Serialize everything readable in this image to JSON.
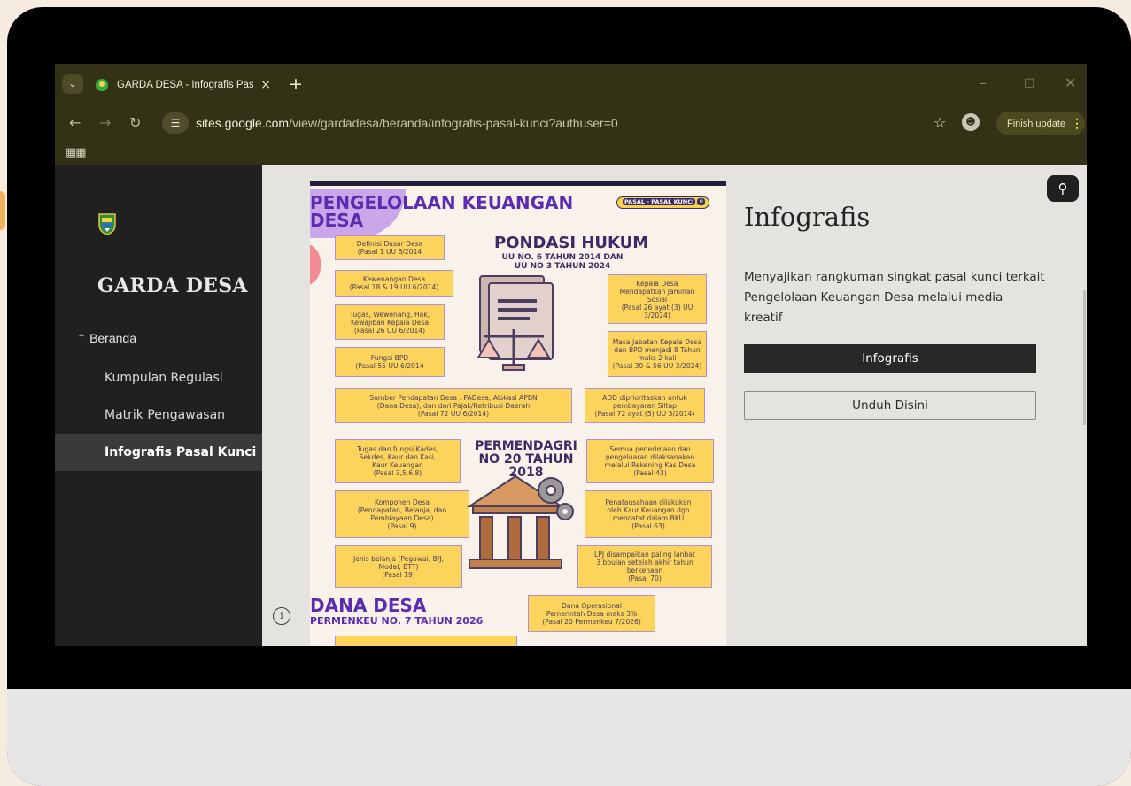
{
  "browser": {
    "tab_title": "GARDA DESA - Infografis Pasal",
    "tab_close": "×",
    "new_tab": "+",
    "url_main": "sites.google.com",
    "url_rest": "/view/gardadesa/beranda/infografis-pasal-kunci?authuser=0",
    "finish_update": "Finish update"
  },
  "sidebar": {
    "site_name": "GARDA DESA",
    "parent": "Beranda",
    "items": [
      {
        "label": "Kumpulan Regulasi"
      },
      {
        "label": "Matrik Pengawasan"
      },
      {
        "label": "Infografis Pasal Kunci"
      }
    ]
  },
  "main": {
    "title": "Infografis",
    "description": "Menyajikan rangkuman singkat pasal kunci terkait Pengelolaan Keuangan Desa melalui media kreatif",
    "primary_button": "Infografis",
    "secondary_button": "Unduh Disini"
  },
  "infographic": {
    "title_line1": "PENGELOLAAN KEUANGAN",
    "title_line2": "DESA",
    "chip": "PASAL - PASAL KUNCI",
    "heading1": "PONDASI HUKUM",
    "heading1_sub1": "UU NO. 6 TAHUN 2014 DAN",
    "heading1_sub2": "UU NO 3 TAHUN 2024",
    "heading2_line1": "PERMENDAGRI",
    "heading2_line2": "NO 20 TAHUN",
    "heading2_line3": "2018",
    "heading3": "DANA DESA",
    "heading3_sub": "PERMENKEU NO. 7 TAHUN 2026",
    "boxes": [
      "Definisi Dasar Desa\n(Pasal 1 UU 6/2014",
      "Kewenangan Desa\n(Pasal 18 & 19 UU 6/2014)",
      "Tugas, Wewenang, Hak,\nKewajiban Kepala Desa\n(Pasal 26 UU 6/2014)",
      "Fungsi BPD\n(Pasal 55 UU 6/2014",
      "Sumber Pendapatan Desa : PADesa, Alokasi APBN\n(Dana Desa), dan dari Pajak/Retribusi Daerah\n(Pasal 72 UU 6/2014)",
      "Kepala Desa\nMendapatkan Jaminan\nSosial\n(Pasal 26 ayat (3) UU\n3/2024)",
      "Masa Jabatan Kepala Desa\ndan BPD menjadi 8 Tahun\nmaks 2 kali\n(Pasal 39 & 56 UU 3/2024)",
      "ADD diprioritaskan untuk\npembayaran Siltap\n(Pasal 72 ayat (5) UU 3/2014)",
      "Tugas dan fungsi Kades,\nSekdes, Kaur dan Kasi,\nKaur Keuangan\n(Pasal 3,5,6,8)",
      "Komponen Desa\n(Pendapatan, Belanja, dan\nPembiayaan Desa)\n(Pasal 9)",
      "Jenis belanja (Pegawai, B/J,\nModal, BTT)\n(Pasal 19)",
      "Semua penerimaan dan\npengeluaran dilaksanakan\nmelalui Rekening Kas Desa\n(Pasal 43)",
      "Penatausahaan dilakukan\noleh Kaur Keuangan dgn\nmencatat dalam BKU\n(Pasal 63)",
      "LPJ disampaikan paling lanbat\n3 bbulan setelah akhir tahun\nberkenaan\n(Pasal 70)",
      "Dana Operasional\nPemerintah Desa maks 3%\n(Pasal 20 Permenkeu 7/2026)"
    ]
  },
  "colors": {
    "frame": "#000000",
    "browser_chrome": "#333216",
    "sidebar": "#202020",
    "page_bg": "#e4e3e0",
    "ig_purple": "#5b2bb1",
    "ig_yellow": "#fcd35b",
    "accent_button": "#282828"
  },
  "icons": [
    "tab-search-icon",
    "site-favicon",
    "close-icon",
    "plus-icon",
    "back-arrow-icon",
    "forward-arrow-icon",
    "reload-icon",
    "site-info-icon",
    "star-icon",
    "profile-icon",
    "kebab-menu-icon",
    "apps-grid-icon",
    "search-icon",
    "info-icon",
    "chevron-up-icon"
  ]
}
